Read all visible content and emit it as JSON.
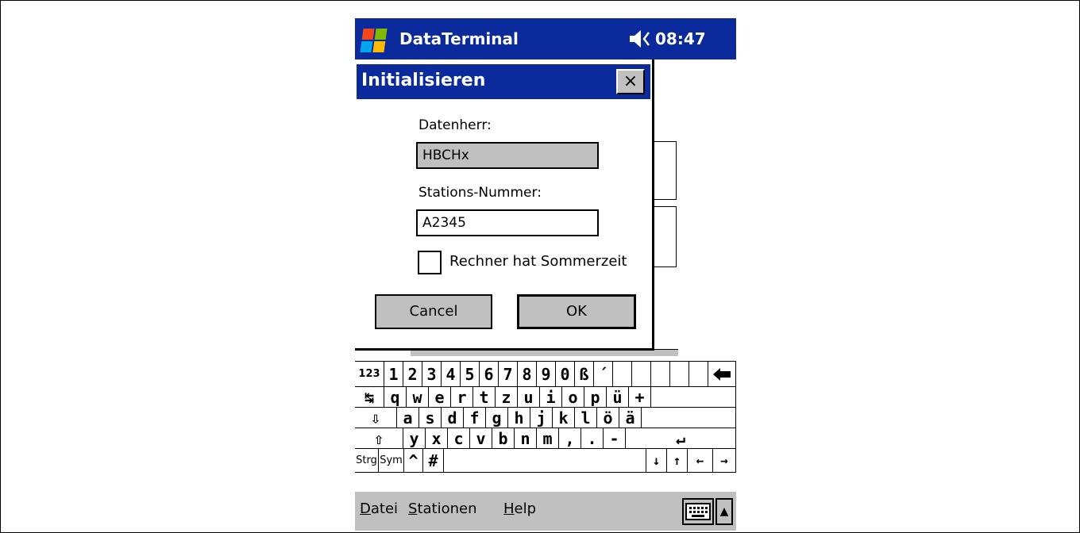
{
  "statusbar": {
    "app_title": "DataTerminal",
    "time": "08:47"
  },
  "dialog": {
    "title": "Initialisieren",
    "close_label": "×",
    "datenherr_label": "Datenherr:",
    "datenherr_value": "HBCHx",
    "station_label": "Stations-Nummer:",
    "station_value": "A2345",
    "checkbox_label": "Rechner hat Sommerzeit",
    "checkbox_checked": false,
    "cancel_label": "Cancel",
    "ok_label": "OK"
  },
  "keyboard": {
    "rows": [
      [
        "123",
        "1",
        "2",
        "3",
        "4",
        "5",
        "6",
        "7",
        "8",
        "9",
        "0",
        "ß",
        "´",
        "🡄"
      ],
      [
        "↹",
        "q",
        "w",
        "e",
        "r",
        "t",
        "z",
        "u",
        "i",
        "o",
        "p",
        "ü",
        "+"
      ],
      [
        "⇩",
        "a",
        "s",
        "d",
        "f",
        "g",
        "h",
        "j",
        "k",
        "l",
        "ö",
        "ä"
      ],
      [
        "⇧",
        "y",
        "x",
        "c",
        "v",
        "b",
        "n",
        "m",
        ",",
        ".",
        "-",
        "↵"
      ],
      [
        "Strg",
        "Sym",
        "^",
        "#",
        "",
        "↓",
        "↑",
        "←",
        "→"
      ]
    ]
  },
  "menubar": {
    "items": [
      {
        "label": "Datei",
        "accel": "D",
        "rest": "atei"
      },
      {
        "label": "Stationen",
        "accel": "S",
        "rest": "tationen"
      },
      {
        "label": "Help",
        "accel": "H",
        "rest": "elp"
      }
    ],
    "keyboard_toggle": "keyboard-icon",
    "sip_arrow": "▲"
  },
  "colors": {
    "titlebar": "#0b2a9b",
    "chrome": "#c0c0c0"
  }
}
